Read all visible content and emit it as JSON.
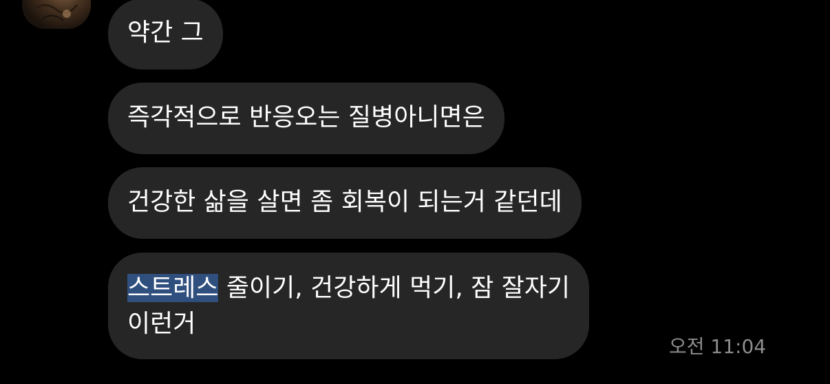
{
  "messages": [
    {
      "text": "약간 그"
    },
    {
      "text": "즉각적으로 반응오는 질병아니면은"
    },
    {
      "text": "건강한 삶을 살면 좀 회복이 되는거 같던데"
    },
    {
      "highlighted": "스트레스",
      "rest": " 줄이기, 건강하게 먹기, 잠 잘자기",
      "line2": "이런거"
    }
  ],
  "timestamp": "오전 11:04",
  "colors": {
    "background": "#000000",
    "bubble": "#262626",
    "text": "#ffffff",
    "selection": "#2f4f7f",
    "timestamp": "#8e8e8e"
  },
  "avatar": {
    "icon": "profile-avatar"
  }
}
